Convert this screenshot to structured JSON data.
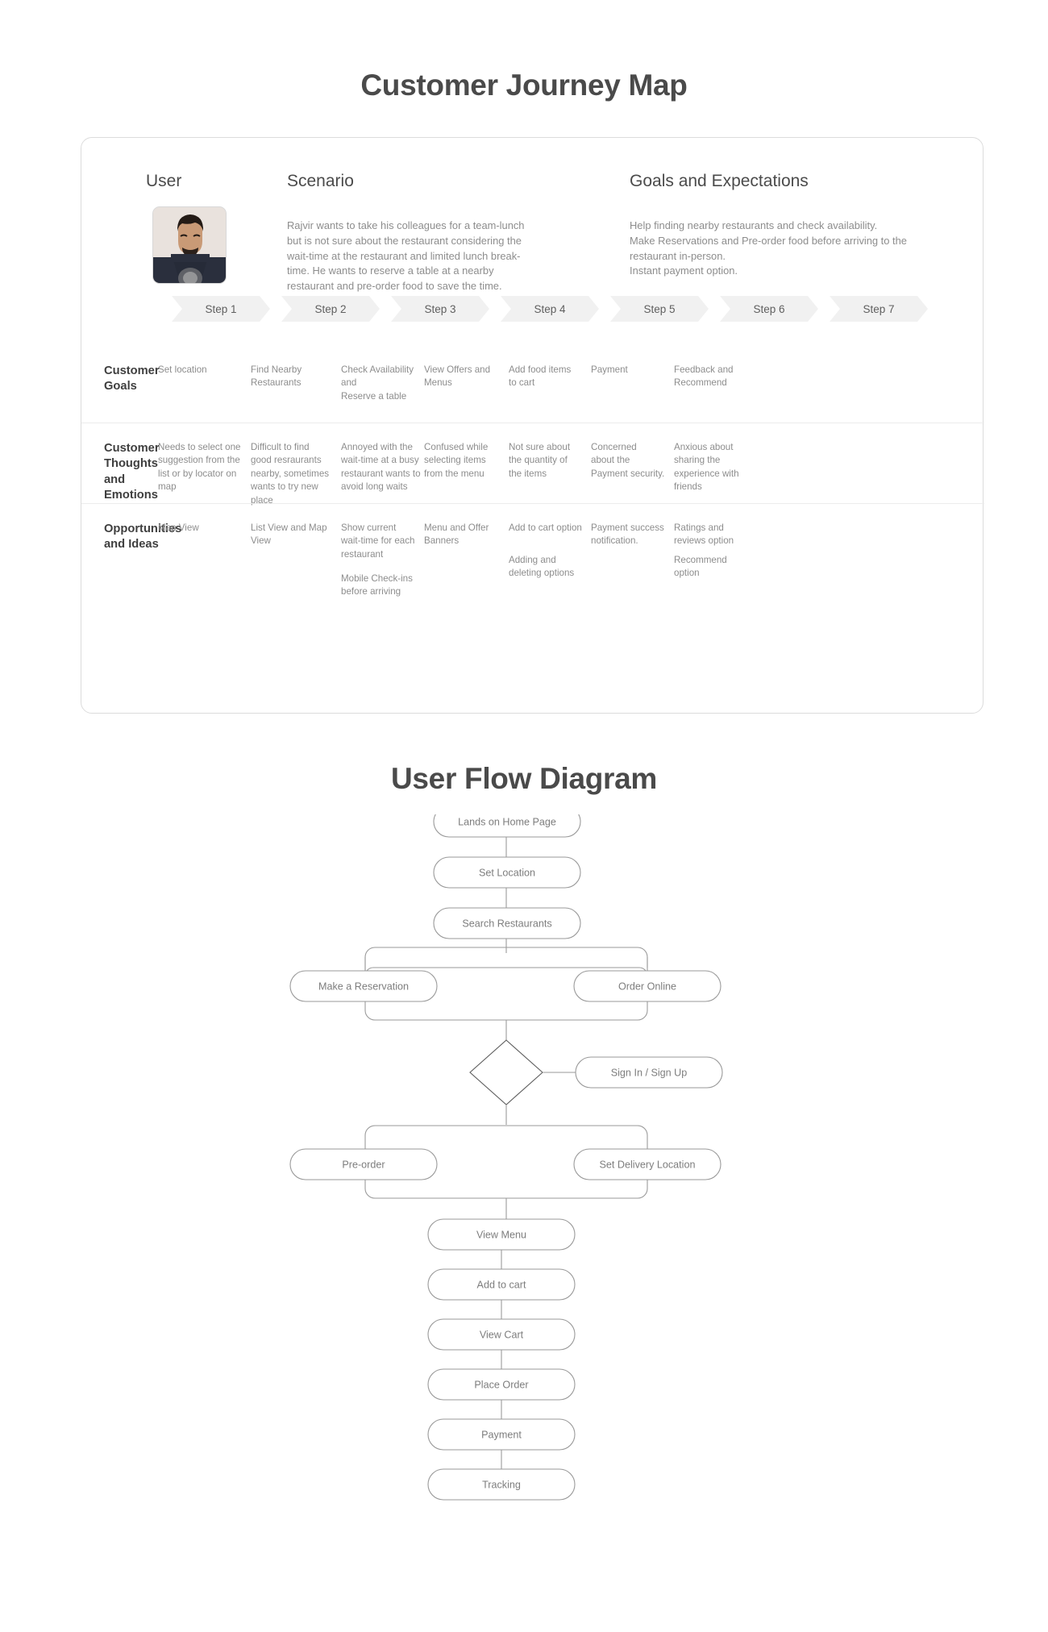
{
  "journey": {
    "title": "Customer Journey Map",
    "headings": {
      "user": "User",
      "scenario": "Scenario",
      "goals": "Goals and Expectations"
    },
    "scenario_text": "Rajvir wants to take his colleagues for a team-lunch but is not sure about the restaurant considering the wait-time at the restaurant and limited lunch break-time. He wants to reserve a table at a nearby restaurant and pre-order food to save the time.",
    "goals_text": "Help finding nearby restaurants and check availability.\nMake Reservations and Pre-order food before arriving to the restaurant in-person.\nInstant payment option.",
    "steps": [
      "Step 1",
      "Step 2",
      "Step 3",
      "Step 4",
      "Step 5",
      "Step 6",
      "Step 7"
    ],
    "rows": [
      {
        "label": "Customer\nGoals",
        "cells": [
          "Set location",
          "Find Nearby\nRestaurants",
          "Check Availability\nand\nReserve a table",
          "View Offers and\nMenus",
          "Add food items\nto cart",
          "Payment",
          "Feedback and\nRecommend"
        ]
      },
      {
        "label": "Customer\nThoughts\nand\nEmotions",
        "cells": [
          "Needs to select one\nsuggestion from the\nlist or by locator on\nmap",
          "Difficult to find\ngood resraurants\nnearby, sometimes\nwants to try new\nplace",
          "Annoyed with the\nwait-time at a busy\nrestaurant wants to\navoid long waits",
          "Confused while\nselecting items\nfrom the menu",
          "Not sure about\nthe quantity of\nthe items",
          "Concerned\nabout the\nPayment security.",
          "Anxious about\nsharing the\nexperience with\nfriends"
        ]
      },
      {
        "label": "Opportunities\nand Ideas",
        "cells": [
          "Map View",
          "List View and Map\nView",
          "Show current\nwait-time for each\nrestaurant",
          "Menu and Offer\nBanners",
          "Add to cart option",
          "Payment success\nnotification.",
          "Ratings and\nreviews option"
        ],
        "cells_extra": [
          "",
          "",
          "Mobile Check-ins\nbefore arriving",
          "",
          "Adding and\ndeleting options",
          "",
          "Recommend\noption"
        ]
      }
    ]
  },
  "flow": {
    "title": "User Flow Diagram",
    "nodes": {
      "lands_home": "Lands on Home Page",
      "set_location": "Set Location",
      "search_restaurants": "Search Restaurants",
      "make_reservation": "Make a Reservation",
      "order_online": "Order Online",
      "sign_in_up": "Sign In / Sign Up",
      "pre_order": "Pre-order",
      "set_delivery_location": "Set Delivery Location",
      "view_menu": "View Menu",
      "add_to_cart": "Add to cart",
      "view_cart": "View Cart",
      "place_order": "Place Order",
      "payment": "Payment",
      "tracking": "Tracking"
    }
  },
  "colors": {
    "title": "#4a4a4a",
    "body": "#8d8d8d",
    "chevron_bg": "#f1f1f1",
    "border": "#9a9a9a"
  }
}
